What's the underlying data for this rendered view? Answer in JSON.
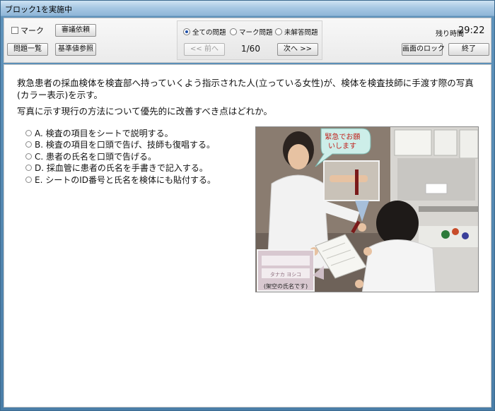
{
  "window": {
    "title": "ブロック1を実施中"
  },
  "toolbar": {
    "mark_label": "マーク",
    "review_button": "審議依頼",
    "question_list_button": "問題一覧",
    "reference_button": "基準値参照",
    "filters": [
      {
        "label": "全ての問題",
        "selected": true
      },
      {
        "label": "マーク問題",
        "selected": false
      },
      {
        "label": "未解答問題",
        "selected": false
      }
    ],
    "prev_button": "<< 前へ",
    "next_button": "次へ >>",
    "counter": "1/60",
    "timer_label": "残り時間",
    "timer_value": "29:22",
    "lock_button": "画面のロック",
    "end_button": "終了"
  },
  "question": {
    "text": "救急患者の採血検体を検査部へ持っていくよう指示された人(立っている女性)が、検体を検査技師に手渡す際の写真(カラー表示)を示す。",
    "prompt": "写真に示す現行の方法について優先的に改善すべき点はどれか。",
    "choices": [
      "A. 検査の項目をシートで説明する。",
      "B. 検査の項目を口頭で告げ、技師も復唱する。",
      "C. 患者の氏名を口頭で告げる。",
      "D. 採血管に患者の氏名を手書きで記入する。",
      "E. シートのID番号と氏名を検体にも貼付する。"
    ]
  },
  "photo": {
    "speech_bubble": "緊急でお願いします",
    "caption": "(架空の氏名です)",
    "inset_text": "タナカ ヨシコ"
  }
}
